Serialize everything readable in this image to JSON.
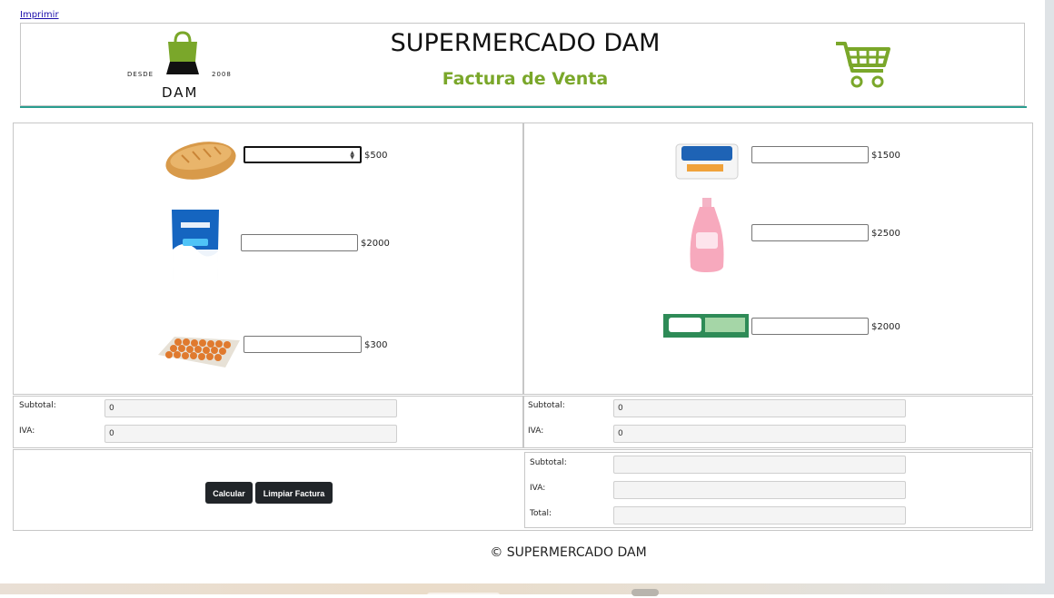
{
  "print_link": "Imprimir",
  "header": {
    "logo": {
      "desde": "DESDE",
      "year": "2008",
      "brand": "DAM"
    },
    "store_title": "SUPERMERCADO DAM",
    "doc_title": "Factura de Venta"
  },
  "products_left": [
    {
      "name": "pan",
      "price": "$500",
      "qty": ""
    },
    {
      "name": "leche",
      "price": "$2000",
      "qty": ""
    },
    {
      "name": "huevos",
      "price": "$300",
      "qty": ""
    }
  ],
  "products_right": [
    {
      "name": "jabon-protex",
      "price": "$1500",
      "qty": ""
    },
    {
      "name": "shampoo-johnsons",
      "price": "$2500",
      "qty": ""
    },
    {
      "name": "crema-dental-oral-b",
      "price": "$2000",
      "qty": ""
    }
  ],
  "summary_left": {
    "subtotal_label": "Subtotal:",
    "subtotal": "0",
    "iva_label": "IVA:",
    "iva": "0"
  },
  "summary_right": {
    "subtotal_label": "Subtotal:",
    "subtotal": "0",
    "iva_label": "IVA:",
    "iva": "0"
  },
  "buttons": {
    "calcular": "Calcular",
    "limpiar": "Limpiar Factura"
  },
  "totals": {
    "subtotal_label": "Subtotal:",
    "subtotal": "",
    "iva_label": "IVA:",
    "iva": "",
    "total_label": "Total:",
    "total": ""
  },
  "footer": "© SUPERMERCADO DAM",
  "colors": {
    "accent_green": "#7aa72a",
    "divider_teal": "#2a9d8f",
    "button_dark": "#212529"
  }
}
